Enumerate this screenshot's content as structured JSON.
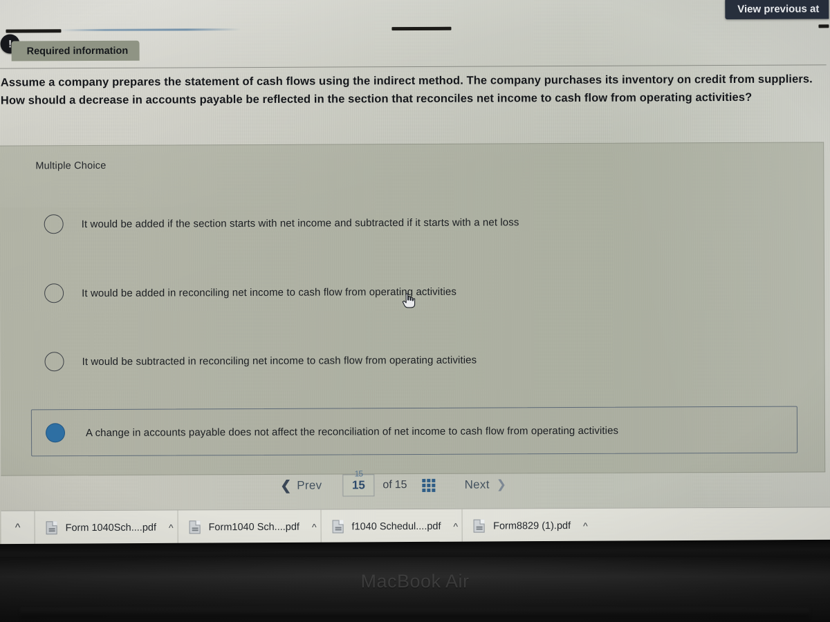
{
  "tooltip": {
    "label": "View previous at"
  },
  "banner": {
    "badge_icon": "exclamation-icon",
    "badge_glyph": "!",
    "title": "Required information"
  },
  "question": {
    "stem": "Assume a company prepares the statement of cash flows using the indirect method. The company purchases its inventory on credit from suppliers. How should a decrease in accounts payable be reflected in the section that reconciles net income to cash flow from operating activities?",
    "type_label": "Multiple Choice",
    "choices": [
      {
        "text": "It would be added if the section starts with net income and subtracted if it starts with a net loss",
        "selected": false
      },
      {
        "text": "It would be added in reconciling net income to cash flow from operating activities",
        "selected": false
      },
      {
        "text": "It would be subtracted in reconciling net income to cash flow from operating activities",
        "selected": false
      },
      {
        "text": "A change in accounts payable does not affect the reconciliation of net income to cash flow from operating activities",
        "selected": true
      }
    ]
  },
  "pager": {
    "prev_label": "Prev",
    "prev_icon": "chevron-left-icon",
    "current_page": "15",
    "ghost_value": "15",
    "of_label": "of",
    "total_pages": "15",
    "grid_icon": "grid-view-icon",
    "next_label": "Next",
    "next_icon": "chevron-right-icon"
  },
  "downloads": {
    "show_all_icon": "chevron-up-icon",
    "items": [
      {
        "filename": "Form 1040Sch....pdf",
        "file_icon": "pdf-file-icon",
        "caret_icon": "chevron-up-icon"
      },
      {
        "filename": "Form1040 Sch....pdf",
        "file_icon": "pdf-file-icon",
        "caret_icon": "chevron-up-icon"
      },
      {
        "filename": "f1040 Schedul....pdf",
        "file_icon": "pdf-file-icon",
        "caret_icon": "chevron-up-icon"
      },
      {
        "filename": "Form8829 (1).pdf",
        "file_icon": "pdf-file-icon",
        "caret_icon": "chevron-up-icon"
      }
    ]
  },
  "device": {
    "brand": "MacBook Air"
  },
  "colors": {
    "selected_radio": "#2e6fa3",
    "tooltip_bg": "#28303e",
    "banner_bg": "#8f9484",
    "accent": "#2f5d86"
  }
}
